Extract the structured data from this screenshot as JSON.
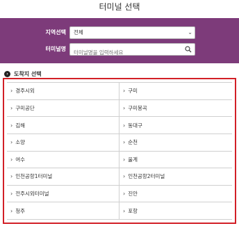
{
  "page": {
    "title": "터미널 선택"
  },
  "filter": {
    "region_label": "지역선택",
    "region_value": "전체",
    "terminal_label": "터미널명",
    "terminal_placeholder": "터미널명을 입력하세요"
  },
  "destination": {
    "heading": "도착지 선택",
    "terminals": [
      "경주시외",
      "구미",
      "구미공단",
      "구미봉곡",
      "김해",
      "동대구",
      "소양",
      "순천",
      "여수",
      "울계",
      "인천공항1터미널",
      "인천공항2터미널",
      "전주시외터미널",
      "진안",
      "청주",
      "포항"
    ]
  },
  "colors": {
    "header_bg": "#7d3b7a",
    "highlight_border": "#d21f26"
  }
}
